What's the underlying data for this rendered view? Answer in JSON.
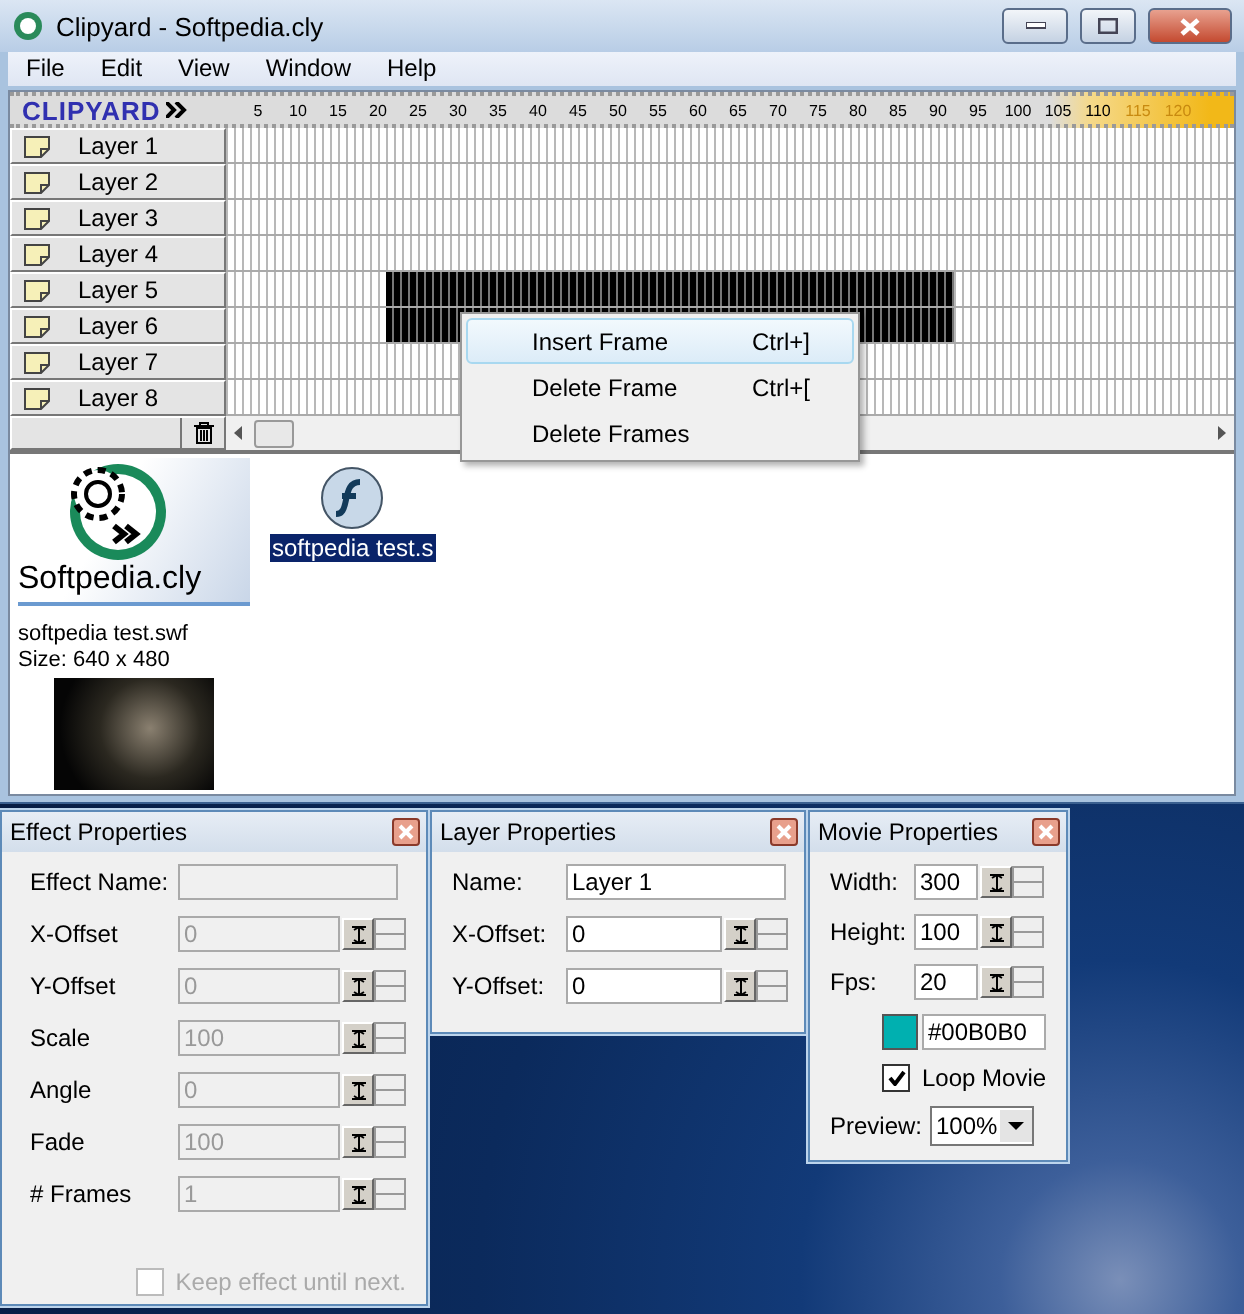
{
  "window": {
    "title": "Clipyard - Softpedia.cly"
  },
  "menu": [
    "File",
    "Edit",
    "View",
    "Window",
    "Help"
  ],
  "logo": {
    "text": "CLIPYARD"
  },
  "ruler": {
    "ticks": [
      "5",
      "10",
      "15",
      "20",
      "25",
      "30",
      "35",
      "40",
      "45",
      "50",
      "55",
      "60",
      "65",
      "70",
      "75",
      "80",
      "85",
      "90",
      "95",
      "100",
      "105",
      "110",
      "115",
      "120"
    ]
  },
  "layers": [
    {
      "name": "Layer 1",
      "selected": false
    },
    {
      "name": "Layer 2",
      "selected": false
    },
    {
      "name": "Layer 3",
      "selected": false
    },
    {
      "name": "Layer 4",
      "selected": false
    },
    {
      "name": "Layer 5",
      "selected": true
    },
    {
      "name": "Layer 6",
      "selected": true
    },
    {
      "name": "Layer 7",
      "selected": false
    },
    {
      "name": "Layer 8",
      "selected": false
    }
  ],
  "context_menu": {
    "items": [
      {
        "label": "Insert Frame",
        "shortcut": "Ctrl+]",
        "selected": true
      },
      {
        "label": "Delete Frame",
        "shortcut": "Ctrl+[",
        "selected": false
      },
      {
        "label": "Delete Frames",
        "selected": false
      }
    ]
  },
  "project": {
    "title": "Softpedia.cly",
    "file_name": "softpedia test.swf",
    "size": "Size: 640 x 480"
  },
  "clips": [
    {
      "label": "softpedia test.s",
      "selected": true
    }
  ],
  "effect_panel": {
    "title": "Effect Properties",
    "name_label": "Effect Name:",
    "fields": [
      {
        "label": "X-Offset",
        "value": "0",
        "disabled": true
      },
      {
        "label": "Y-Offset",
        "value": "0",
        "disabled": true
      },
      {
        "label": "Scale",
        "value": "100",
        "disabled": true
      },
      {
        "label": "Angle",
        "value": "0",
        "disabled": true
      },
      {
        "label": "Fade",
        "value": "100",
        "disabled": true
      },
      {
        "label": "# Frames",
        "value": "1",
        "disabled": true
      }
    ],
    "keep_checkbox": {
      "label": "Keep effect until next.",
      "checked": false,
      "disabled": true
    }
  },
  "layer_panel": {
    "title": "Layer Properties",
    "name_label": "Name:",
    "name_value": "Layer 1",
    "fields": [
      {
        "label": "X-Offset:",
        "value": "0",
        "disabled": false
      },
      {
        "label": "Y-Offset:",
        "value": "0",
        "disabled": false
      }
    ]
  },
  "movie_panel": {
    "title": "Movie Properties",
    "fields": [
      {
        "label": "Width:",
        "value": "300",
        "disabled": false
      },
      {
        "label": "Height:",
        "value": "100",
        "disabled": false
      },
      {
        "label": "Fps:",
        "value": "20",
        "disabled": false
      }
    ],
    "background": {
      "value": "#00B0B0",
      "color": "#00b0b0"
    },
    "loop": {
      "label": "Loop Movie",
      "checked": true
    },
    "preview": {
      "label": "Preview:",
      "value": "100%"
    }
  }
}
